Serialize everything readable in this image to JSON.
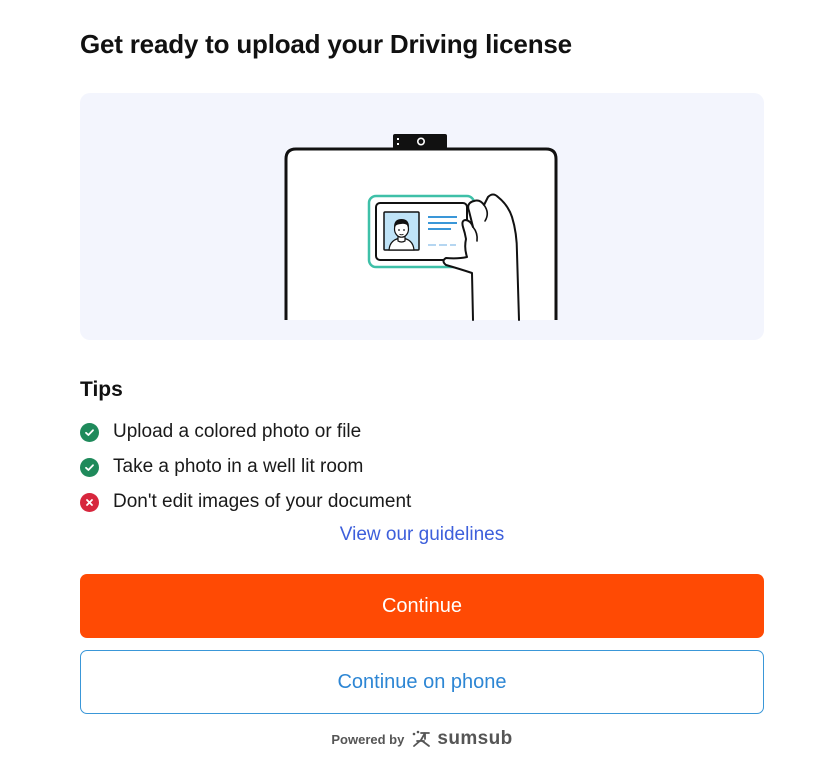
{
  "page": {
    "title": "Get ready to upload your Driving license"
  },
  "illustration": {
    "icon": "phone-holding-id-card-illustration",
    "colors": {
      "panel_bg": "#f3f5fd",
      "card_outline": "#3ec0a8",
      "card_accent": "#3a97d8",
      "photo_bg": "#bfe3f7"
    }
  },
  "tips": {
    "title": "Tips",
    "items": [
      {
        "text": "Upload a colored photo or file",
        "status": "ok",
        "icon": "check-circle-icon"
      },
      {
        "text": "Take a photo in a well lit room",
        "status": "ok",
        "icon": "check-circle-icon"
      },
      {
        "text": "Don't edit images of your document",
        "status": "bad",
        "icon": "x-circle-icon"
      }
    ]
  },
  "guidelines_link": "View our guidelines",
  "actions": {
    "continue_label": "Continue",
    "continue_phone_label": "Continue on phone"
  },
  "footer": {
    "powered_by": "Powered by",
    "brand": "sumsub",
    "brand_icon": "sumsub-logo-icon"
  },
  "colors": {
    "primary": "#ff4a04",
    "link": "#3d5fdb",
    "secondary_text": "#2d86d4",
    "success": "#1f8a5b",
    "error": "#d7263d"
  }
}
